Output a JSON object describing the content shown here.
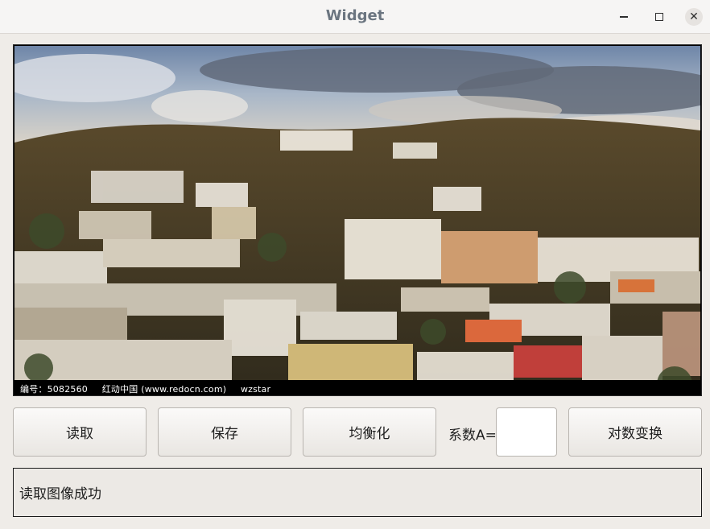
{
  "window": {
    "title": "Widget"
  },
  "image": {
    "watermark_id": "编号：5082560",
    "watermark_site": "红动中国 (www.redocn.com)",
    "watermark_author": "wzstar"
  },
  "toolbar": {
    "read_label": "读取",
    "save_label": "保存",
    "equalize_label": "均衡化",
    "coef_label": "系数A=",
    "coef_value": "",
    "log_label": "对数变换"
  },
  "status": {
    "message": "读取图像成功"
  },
  "icons": {
    "minimize": "minimize-icon",
    "maximize": "maximize-icon",
    "close": "close-icon"
  }
}
